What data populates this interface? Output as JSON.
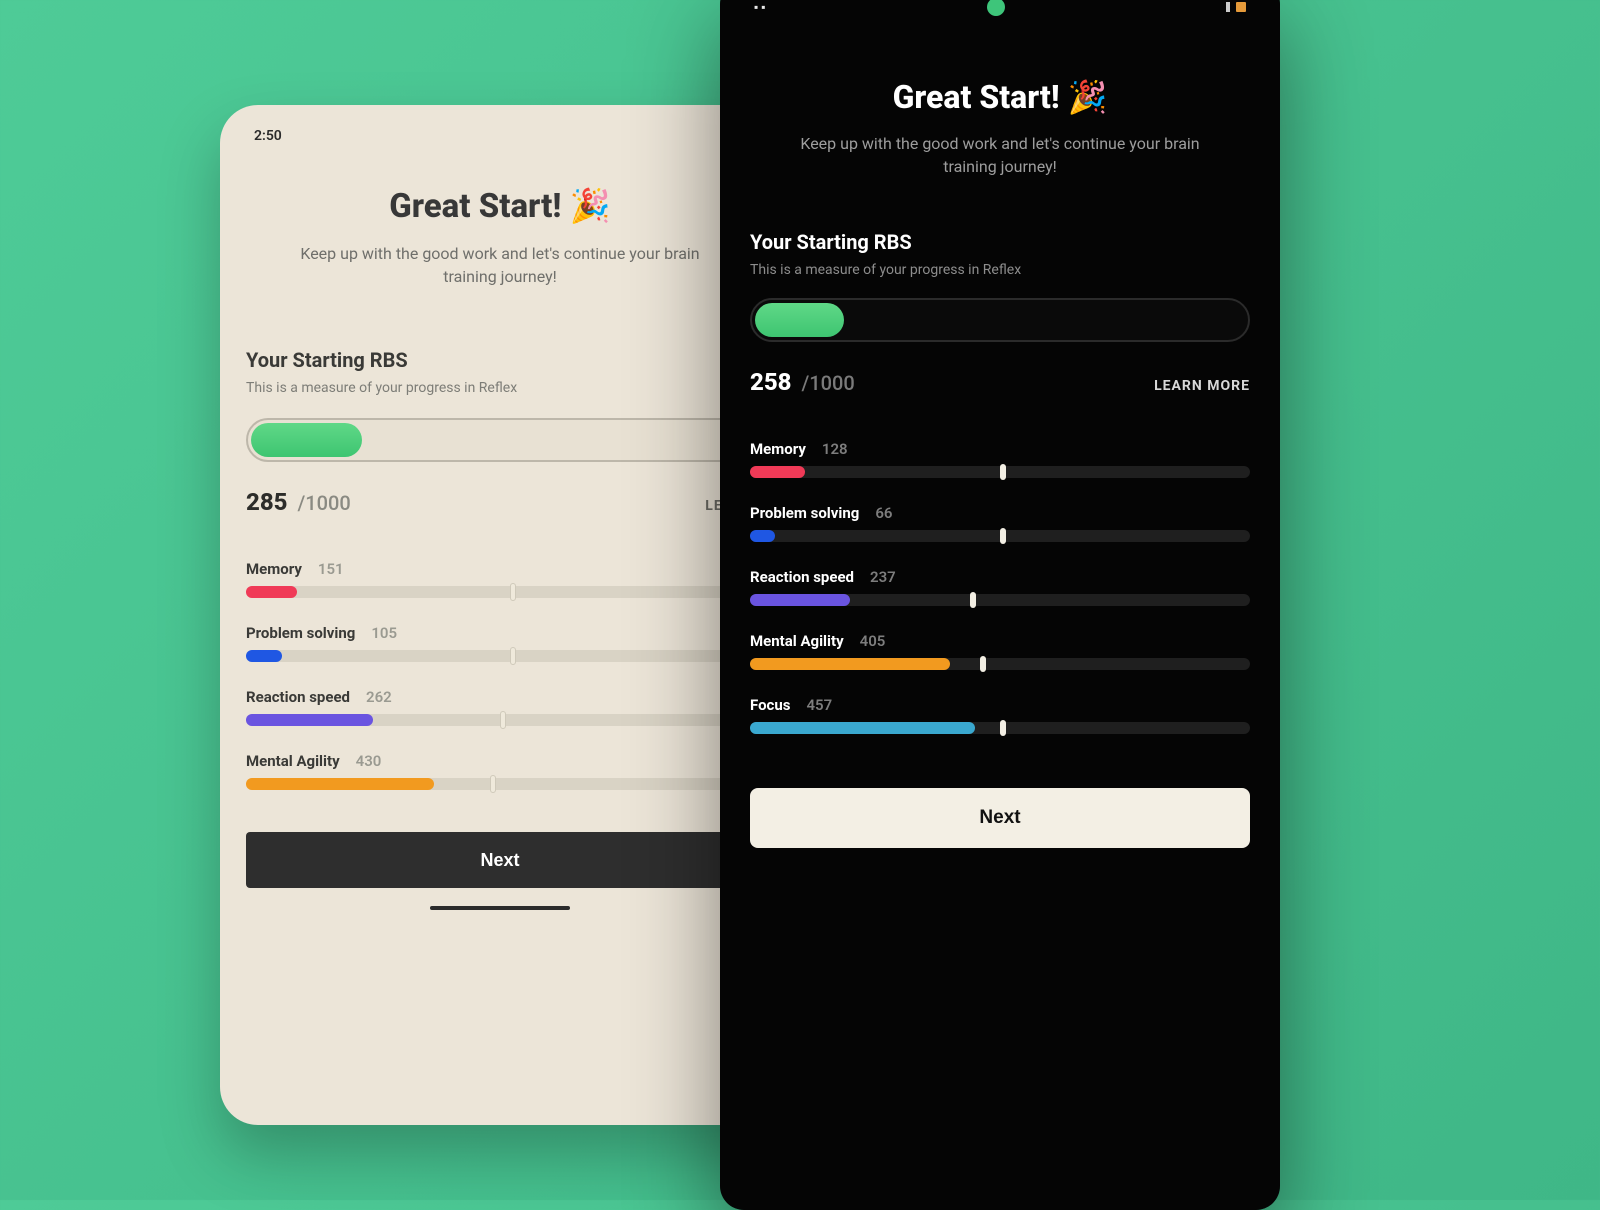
{
  "shared": {
    "title": "Great Start! 🎉",
    "subtitle": "Keep up with the good work and let's continue your brain training journey!",
    "section_label": "Your Starting RBS",
    "section_sub": "This is a measure of your progress in Reflex",
    "score_max_label": "/1000",
    "learn_more": "LEARN MORE",
    "next": "Next"
  },
  "light": {
    "clock": "2:50",
    "rbs_score": "285",
    "rbs_fill_pct": 22,
    "learn_partial": "LEARN",
    "metrics": [
      {
        "name": "Memory",
        "value": "151",
        "fill_pct": 10,
        "knob_pct": 52,
        "color": "c-red"
      },
      {
        "name": "Problem solving",
        "value": "105",
        "fill_pct": 7,
        "knob_pct": 52,
        "color": "c-blue"
      },
      {
        "name": "Reaction speed",
        "value": "262",
        "fill_pct": 25,
        "knob_pct": 50,
        "color": "c-purple"
      },
      {
        "name": "Mental Agility",
        "value": "430",
        "fill_pct": 37,
        "knob_pct": 48,
        "color": "c-orange"
      }
    ]
  },
  "dark": {
    "rbs_score": "258",
    "rbs_fill_pct": 18,
    "metrics": [
      {
        "name": "Memory",
        "value": "128",
        "fill_pct": 11,
        "knob_pct": 50,
        "color": "c-red"
      },
      {
        "name": "Problem solving",
        "value": "66",
        "fill_pct": 5,
        "knob_pct": 50,
        "color": "c-blue"
      },
      {
        "name": "Reaction speed",
        "value": "237",
        "fill_pct": 20,
        "knob_pct": 44,
        "color": "c-purple"
      },
      {
        "name": "Mental Agility",
        "value": "405",
        "fill_pct": 40,
        "knob_pct": 46,
        "color": "c-orange"
      },
      {
        "name": "Focus",
        "value": "457",
        "fill_pct": 45,
        "knob_pct": 50,
        "color": "c-cyan"
      }
    ]
  },
  "chart_data": [
    {
      "type": "bar",
      "title": "Your Starting RBS (Light)",
      "categories": [
        "Memory",
        "Problem solving",
        "Reaction speed",
        "Mental Agility"
      ],
      "values": [
        151,
        105,
        262,
        430
      ],
      "ylim": [
        0,
        1000
      ],
      "overall_score": 285
    },
    {
      "type": "bar",
      "title": "Your Starting RBS (Dark)",
      "categories": [
        "Memory",
        "Problem solving",
        "Reaction speed",
        "Mental Agility",
        "Focus"
      ],
      "values": [
        128,
        66,
        237,
        405,
        457
      ],
      "ylim": [
        0,
        1000
      ],
      "overall_score": 258
    }
  ]
}
